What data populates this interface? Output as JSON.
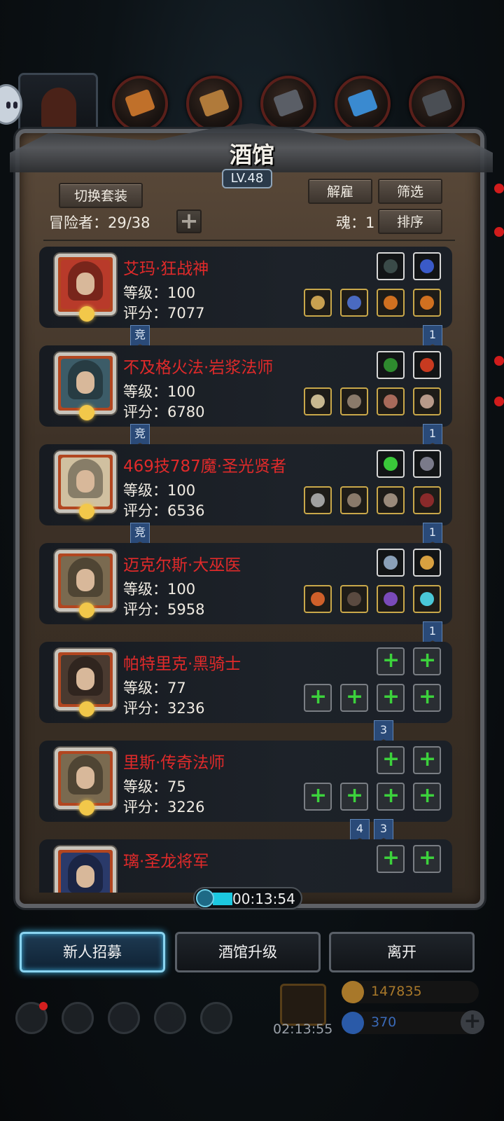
{
  "tavern": {
    "title": "酒馆",
    "level": "LV.48",
    "switch_outfit": "切换套装",
    "dismiss": "解雇",
    "filter": "筛选",
    "sort": "排序",
    "adventurer_count": "冒险者：29/38",
    "soul": "魂：1",
    "add": "+"
  },
  "heroes": [
    {
      "name": "艾玛·狂战神",
      "level": "等级：100",
      "score": "评分：7077",
      "portrait_color": "#b83a2a",
      "top_items": [
        {
          "icon": "stone-icon",
          "color": "#3a4a48"
        },
        {
          "icon": "potion-icon",
          "color": "#3a5ac8"
        }
      ],
      "bottom_items": [
        {
          "icon": "axe-icon",
          "color": "#c8a050"
        },
        {
          "icon": "robe-icon",
          "color": "#4a6ac0"
        },
        {
          "icon": "ring-icon",
          "color": "#d07020"
        },
        {
          "icon": "ring-icon",
          "color": "#d07020"
        }
      ],
      "tags": [
        "竞",
        "1"
      ]
    },
    {
      "name": "不及格火法·岩浆法师",
      "level": "等级：100",
      "score": "评分：6780",
      "portrait_color": "#3c5c68",
      "top_items": [
        {
          "icon": "scroll-icon",
          "color": "#2e8a2e"
        },
        {
          "icon": "crown-icon",
          "color": "#c83a20"
        }
      ],
      "bottom_items": [
        {
          "icon": "wand-icon",
          "color": "#c8b890"
        },
        {
          "icon": "staff-icon",
          "color": "#8a7a6a"
        },
        {
          "icon": "orb-icon",
          "color": "#a86a5a"
        },
        {
          "icon": "shell-icon",
          "color": "#b89a8a"
        }
      ],
      "tags": [
        "竞",
        "1"
      ]
    },
    {
      "name": "469技787魔·圣光贤者",
      "level": "等级：100",
      "score": "评分：6536",
      "portrait_color": "#d0c0a0",
      "top_items": [
        {
          "icon": "lantern-icon",
          "color": "#3ac83a"
        },
        {
          "icon": "amulet-icon",
          "color": "#7a7a8a"
        }
      ],
      "bottom_items": [
        {
          "icon": "hammer-icon",
          "color": "#a0a0a0"
        },
        {
          "icon": "armor-icon",
          "color": "#8a7a6a"
        },
        {
          "icon": "glove-icon",
          "color": "#9a8a7a"
        },
        {
          "icon": "bracer-icon",
          "color": "#8a2a2a"
        }
      ],
      "tags": [
        "竞",
        "1"
      ]
    },
    {
      "name": "迈克尔斯·大巫医",
      "level": "等级：100",
      "score": "评分：5958",
      "portrait_color": "#7a6a50",
      "top_items": [
        {
          "icon": "book-icon",
          "color": "#8aa0b8"
        },
        {
          "icon": "pendant-icon",
          "color": "#d8a040"
        }
      ],
      "bottom_items": [
        {
          "icon": "torch-icon",
          "color": "#d0602a"
        },
        {
          "icon": "vest-icon",
          "color": "#5a4a40"
        },
        {
          "icon": "bangle-icon",
          "color": "#7a4ab8"
        },
        {
          "icon": "rune-icon",
          "color": "#4ac8d8"
        }
      ],
      "tags": [
        "1"
      ]
    },
    {
      "name": "帕特里克·黑骑士",
      "level": "等级：77",
      "score": "评分：3236",
      "portrait_color": "#4a3a30",
      "top_items": [
        {
          "icon": "add-icon",
          "color": ""
        },
        {
          "icon": "add-icon",
          "color": ""
        }
      ],
      "bottom_items": [
        {
          "icon": "add-icon",
          "color": ""
        },
        {
          "icon": "add-icon",
          "color": ""
        },
        {
          "icon": "add-icon",
          "color": ""
        },
        {
          "icon": "add-icon",
          "color": ""
        }
      ],
      "tags": [
        "3"
      ]
    },
    {
      "name": "里斯·传奇法师",
      "level": "等级：75",
      "score": "评分：3226",
      "portrait_color": "#7a6a50",
      "top_items": [
        {
          "icon": "add-icon",
          "color": ""
        },
        {
          "icon": "add-icon",
          "color": ""
        }
      ],
      "bottom_items": [
        {
          "icon": "add-icon",
          "color": ""
        },
        {
          "icon": "add-icon",
          "color": ""
        },
        {
          "icon": "add-icon",
          "color": ""
        },
        {
          "icon": "add-icon",
          "color": ""
        }
      ],
      "tags": [
        "4",
        "3"
      ]
    },
    {
      "name": "璃·圣龙将军",
      "level": "",
      "score": "",
      "portrait_color": "#2a3a6a",
      "top_items": [
        {
          "icon": "add-icon",
          "color": ""
        },
        {
          "icon": "add-icon",
          "color": ""
        }
      ],
      "bottom_items": [],
      "tags": []
    }
  ],
  "timer": {
    "text": "00:13:54",
    "progress": 0.2
  },
  "actions": {
    "recruit": "新人招募",
    "upgrade": "酒馆升级",
    "leave": "离开"
  },
  "bottom": {
    "gift_timer": "02:13:55",
    "gold": "147835",
    "gems": "370"
  },
  "colors": {
    "name_red": "#e02a2a",
    "accent_cyan": "#1cc8e0",
    "gold_text": "#a8782a",
    "gem_text": "#3a6ab8"
  }
}
